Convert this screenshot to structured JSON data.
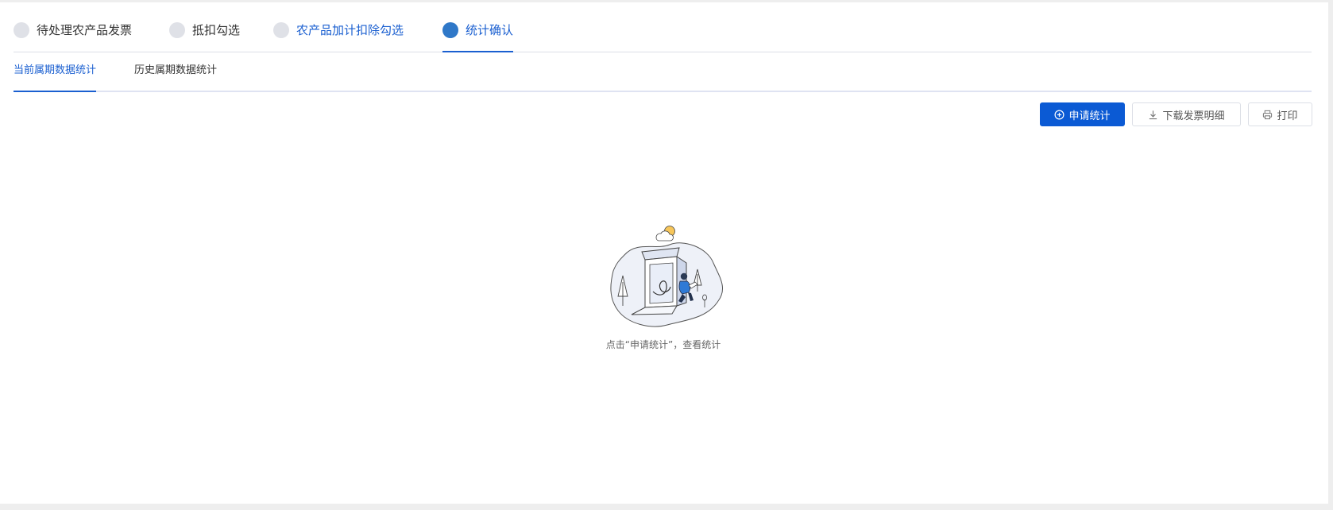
{
  "steps": [
    {
      "label": "待处理农产品发票",
      "state": "pending"
    },
    {
      "label": "抵扣勾选",
      "state": "pending"
    },
    {
      "label": "农产品加计扣除勾选",
      "state": "link"
    },
    {
      "label": "统计确认",
      "state": "active"
    }
  ],
  "subtabs": [
    {
      "label": "当前属期数据统计",
      "active": true
    },
    {
      "label": "历史属期数据统计",
      "active": false
    }
  ],
  "toolbar": {
    "apply_label": "申请统计",
    "download_label": "下载发票明细",
    "print_label": "打印"
  },
  "empty_state": {
    "message": "点击“申请统计”，查看统计",
    "illustration": "person-sitting-by-open-box-illustration"
  },
  "colors": {
    "accent": "#1a5fd0",
    "primary_button": "#0b5ad4",
    "step_inactive": "#dfe1e7",
    "step_active": "#2f78c8"
  }
}
